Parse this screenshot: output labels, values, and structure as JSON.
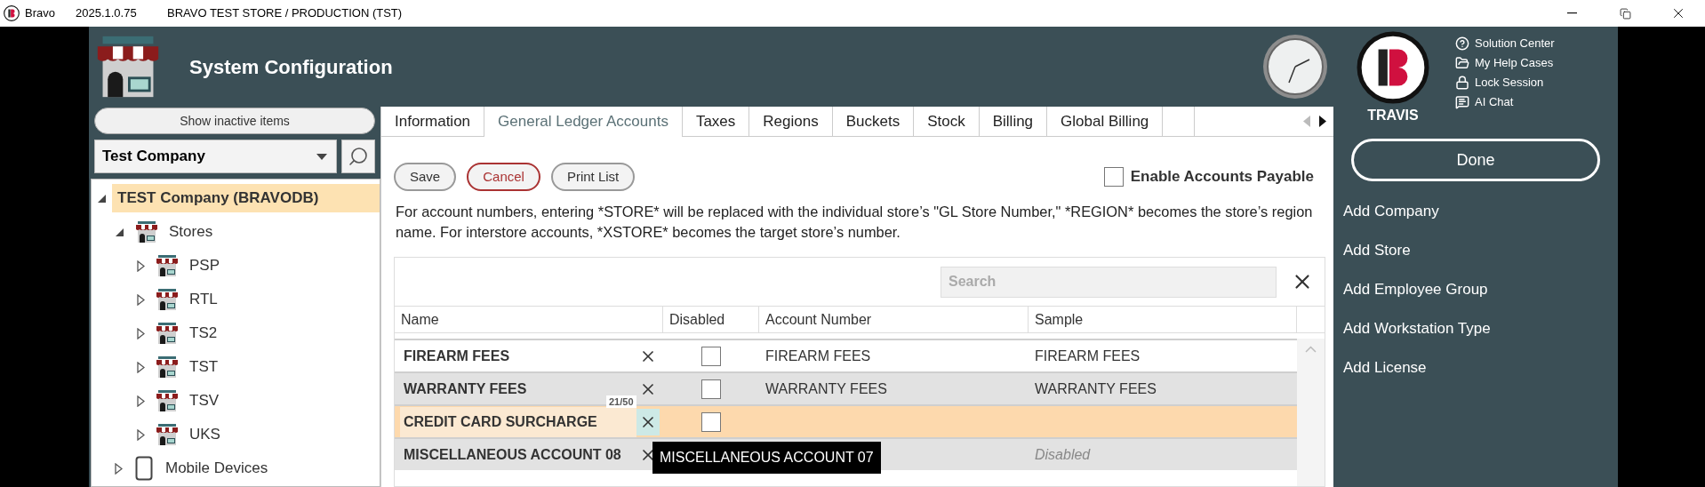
{
  "title_bar": {
    "app": "Bravo",
    "version": "2025.1.0.75",
    "store": "BRAVO TEST STORE / PRODUCTION (TST)"
  },
  "header": {
    "title": "System Configuration"
  },
  "user": {
    "name": "TRAVIS"
  },
  "help_links": [
    {
      "label": "Solution Center",
      "kind": "help"
    },
    {
      "label": "My Help Cases",
      "kind": "cases"
    },
    {
      "label": "Lock Session",
      "kind": "lock"
    },
    {
      "label": "AI Chat",
      "kind": "chat"
    }
  ],
  "sidebar": {
    "show_inactive_button": "Show inactive items",
    "company_select": {
      "value": "Test Company"
    },
    "tree": [
      {
        "label": "TEST Company (BRAVODB)",
        "kind": "company",
        "expanded": true,
        "selected": true,
        "children": [
          {
            "label": "Stores",
            "kind": "stores",
            "expanded": true,
            "selected": false,
            "children": [
              {
                "label": "PSP",
                "kind": "store",
                "expanded": false,
                "selected": false
              },
              {
                "label": "RTL",
                "kind": "store",
                "expanded": false,
                "selected": false
              },
              {
                "label": "TS2",
                "kind": "store",
                "expanded": false,
                "selected": false
              },
              {
                "label": "TST",
                "kind": "store",
                "expanded": false,
                "selected": false
              },
              {
                "label": "TSV",
                "kind": "store",
                "expanded": false,
                "selected": false
              },
              {
                "label": "UKS",
                "kind": "store",
                "expanded": false,
                "selected": false
              }
            ]
          },
          {
            "label": "Mobile Devices",
            "kind": "device",
            "expanded": false,
            "selected": false
          }
        ]
      }
    ]
  },
  "tabs": [
    {
      "label": "Information",
      "selected": false
    },
    {
      "label": "General Ledger Accounts",
      "selected": true
    },
    {
      "label": "Taxes",
      "selected": false
    },
    {
      "label": "Regions",
      "selected": false
    },
    {
      "label": "Buckets",
      "selected": false
    },
    {
      "label": "Stock",
      "selected": false
    },
    {
      "label": "Billing",
      "selected": false
    },
    {
      "label": "Global Billing",
      "selected": false
    }
  ],
  "toolbar": [
    {
      "label": "Save",
      "kind": "default"
    },
    {
      "label": "Cancel",
      "kind": "cancel"
    },
    {
      "label": "Print List",
      "kind": "default"
    }
  ],
  "enable_accounts_payable": {
    "label": "Enable Accounts Payable",
    "checked": false
  },
  "description": "For account numbers, entering *STORE* will be replaced with the individual store’s \"GL Store Number,\" *REGION* becomes the store’s region name. For interstore accounts, *XSTORE* becomes the target store’s number.",
  "table": {
    "search": {
      "placeholder": "Search"
    },
    "columns": [
      "Name",
      "Disabled",
      "Account Number",
      "Sample"
    ],
    "rows": [
      {
        "name": "FIREARM FEES",
        "disabled": false,
        "account_number": "FIREARM FEES",
        "sample": "FIREARM FEES",
        "sample_muted": false,
        "selected": false
      },
      {
        "name": "WARRANTY FEES",
        "disabled": false,
        "account_number": "WARRANTY FEES",
        "sample": "WARRANTY FEES",
        "sample_muted": false,
        "selected": false
      },
      {
        "name": "CREDIT CARD SURCHARGE",
        "disabled": false,
        "char_count": "21/50",
        "selected": true
      },
      {
        "name": "MISCELLANEOUS ACCOUNT 08",
        "sample": "Disabled",
        "sample_muted": true,
        "selected": false
      }
    ],
    "tooltip": "MISCELLANEOUS ACCOUNT 07"
  },
  "actions": [
    "Add Company",
    "Add Store",
    "Add Employee Group",
    "Add Workstation Type",
    "Add License"
  ],
  "done_button": "Done"
}
